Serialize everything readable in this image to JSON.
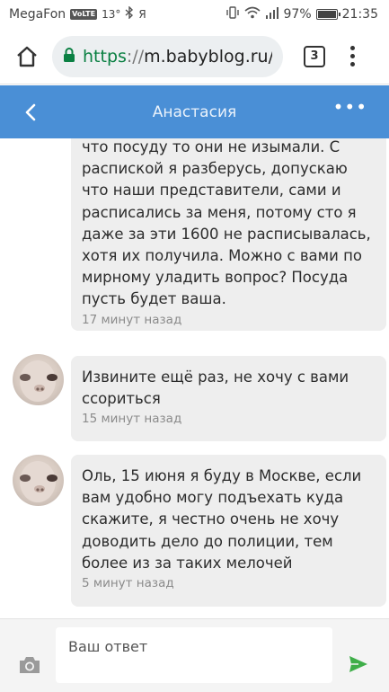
{
  "statusbar": {
    "carrier": "MegaFon",
    "volte": "VoLTE",
    "temperature": "13°",
    "ya": "Я",
    "battery": "97%",
    "time": "21:35"
  },
  "browser": {
    "url_scheme": "https",
    "url_sep": "://",
    "url_host": "m.babyblog.ru/u",
    "tab_count": "3"
  },
  "header": {
    "title": "Анастасия"
  },
  "messages": [
    {
      "text": "что посуду то они не изымали. С распиской я разберусь, допускаю что наши представители, сами и расписались за меня, потому сто я даже за эти 1600 не расписывалась, хотя их получила. Можно с вами по мирному уладить вопрос? Посуда пусть будет ваша.",
      "time": "17 минут назад"
    },
    {
      "text": "Извините ещё раз, не хочу с вами ссориться",
      "time": "15 минут назад"
    },
    {
      "text": "Оль, 15 июня я буду в Москве, если вам удобно могу подъехать куда скажите, я честно очень не хочу доводить дело до полиции, тем более из за таких мелочей",
      "time": "5 минут назад"
    }
  ],
  "composer": {
    "placeholder": "Ваш ответ"
  },
  "colors": {
    "header_blue": "#4a8fd6",
    "send_green": "#3fae49",
    "secure_green": "#0b8043"
  }
}
